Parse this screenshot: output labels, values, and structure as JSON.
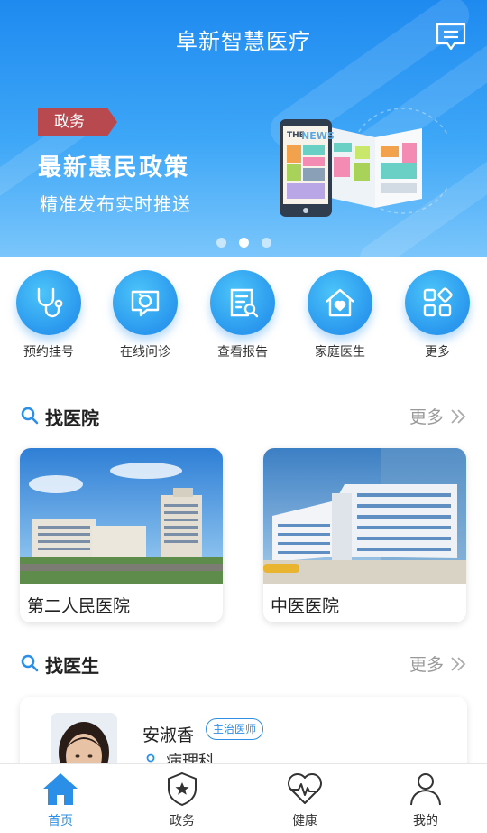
{
  "header": {
    "title": "阜新智慧医疗",
    "message_icon": "message-icon"
  },
  "banner": {
    "tag": "政务",
    "headline": "最新惠民政策",
    "subline": "精准发布实时推送",
    "dots": [
      false,
      true,
      false
    ]
  },
  "quick_actions": [
    {
      "label": "预约挂号",
      "icon": "stethoscope-icon"
    },
    {
      "label": "在线问诊",
      "icon": "chat-refresh-icon"
    },
    {
      "label": "查看报告",
      "icon": "report-search-icon"
    },
    {
      "label": "家庭医生",
      "icon": "home-heart-icon"
    },
    {
      "label": "更多",
      "icon": "grid-icon"
    }
  ],
  "hospital_section": {
    "title": "找医院",
    "more": "更多"
  },
  "hospitals": [
    {
      "name": "第二人民医院"
    },
    {
      "name": "中医医院"
    }
  ],
  "doctor_section": {
    "title": "找医生",
    "more": "更多"
  },
  "doctors": [
    {
      "name": "安淑香",
      "title": "主治医师",
      "department": "病理科"
    }
  ],
  "tabs": [
    {
      "label": "首页",
      "icon": "home-icon",
      "active": true
    },
    {
      "label": "政务",
      "icon": "shield-star-icon",
      "active": false
    },
    {
      "label": "健康",
      "icon": "heart-pulse-icon",
      "active": false
    },
    {
      "label": "我的",
      "icon": "user-icon",
      "active": false
    }
  ],
  "colors": {
    "primary": "#2b8fe8",
    "tag_bg": "#b84a4f"
  }
}
